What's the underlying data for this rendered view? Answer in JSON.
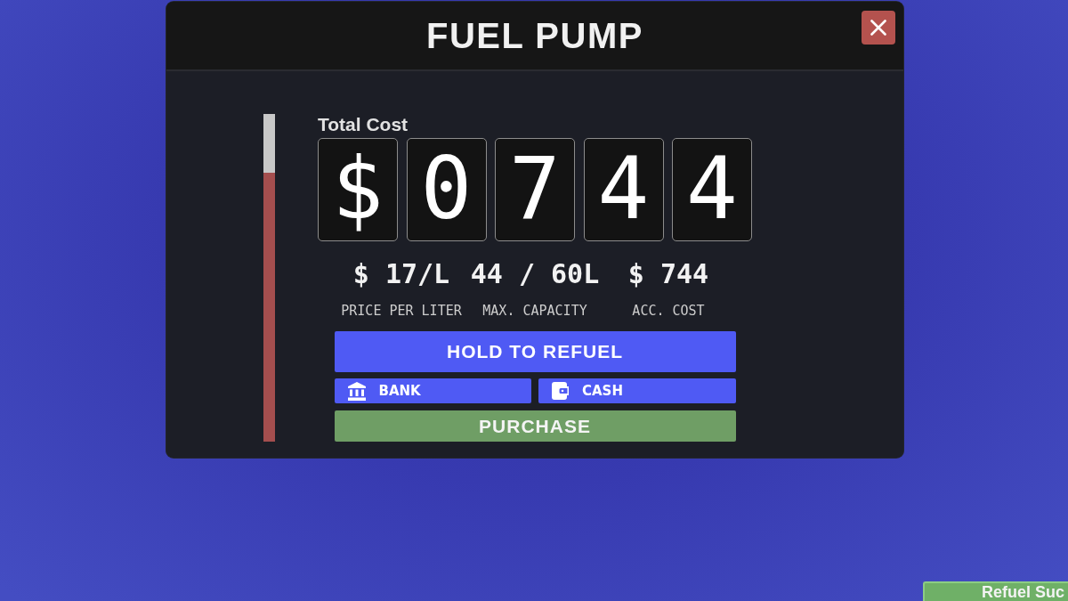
{
  "window": {
    "title": "FUEL PUMP"
  },
  "fuel_gauge": {
    "level": 0.82
  },
  "total_cost": {
    "label": "Total Cost",
    "digits": [
      "$",
      "0",
      "7",
      "4",
      "4"
    ]
  },
  "stats": [
    {
      "value": "$ 17/L",
      "label": "PRICE PER LITER"
    },
    {
      "value": "44 / 60L",
      "label": "MAX. CAPACITY"
    },
    {
      "value": "$ 744",
      "label": "ACC. COST"
    }
  ],
  "refuel_button": {
    "label": "HOLD TO REFUEL"
  },
  "payment_methods": [
    {
      "kind": "bank",
      "label": "BANK"
    },
    {
      "kind": "cash",
      "label": "CASH"
    }
  ],
  "purchase_button": {
    "label": "PURCHASE"
  },
  "toast": {
    "text": "Refuel Suc"
  }
}
